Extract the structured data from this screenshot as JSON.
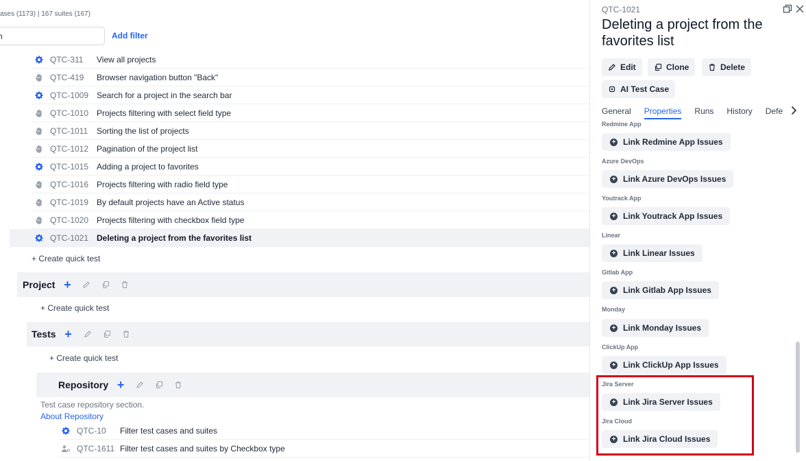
{
  "header": {
    "summary": "ases (1173) | 167 suites (167)",
    "search_value": "h",
    "add_filter": "Add filter"
  },
  "tests_top": [
    {
      "type": "automated",
      "id": "QTC-311",
      "title": "View all projects"
    },
    {
      "type": "manual",
      "id": "QTC-419",
      "title": "Browser navigation button \"Back\""
    },
    {
      "type": "automated",
      "id": "QTC-1009",
      "title": "Search for a project in the search bar"
    },
    {
      "type": "manual",
      "id": "QTC-1010",
      "title": "Projects filtering with select field type"
    },
    {
      "type": "manual",
      "id": "QTC-1011",
      "title": "Sorting the list of projects"
    },
    {
      "type": "manual",
      "id": "QTC-1012",
      "title": "Pagination of the project list"
    },
    {
      "type": "automated",
      "id": "QTC-1015",
      "title": "Adding a project to favorites"
    },
    {
      "type": "manual",
      "id": "QTC-1016",
      "title": "Projects filtering with radio field type"
    },
    {
      "type": "manual",
      "id": "QTC-1019",
      "title": "By default projects have an Active status"
    },
    {
      "type": "manual",
      "id": "QTC-1020",
      "title": "Projects filtering with checkbox field type"
    },
    {
      "type": "automated",
      "id": "QTC-1021",
      "title": "Deleting a project from the favorites list",
      "selected": true
    }
  ],
  "quick_test": "+ Create quick test",
  "suites": {
    "project": "Project",
    "tests": "Tests",
    "repository": "Repository"
  },
  "repository": {
    "description": "Test case repository section.",
    "about_link": "About Repository"
  },
  "tests_bottom": [
    {
      "type": "automated",
      "id": "QTC-10",
      "title": "Filter test cases and suites"
    },
    {
      "type": "user",
      "id": "QTC-1611",
      "title": "Filter test cases and suites by Checkbox type"
    }
  ],
  "panel": {
    "id": "QTC-1021",
    "title": "Deleting a project from the favorites list",
    "buttons": {
      "edit": "Edit",
      "clone": "Clone",
      "delete": "Delete",
      "ai": "AI Test Case"
    },
    "tabs": [
      "General",
      "Properties",
      "Runs",
      "History",
      "Defe"
    ],
    "active_tab": "Properties",
    "integrations": [
      {
        "label": "Redmine App",
        "button": "Link Redmine App Issues"
      },
      {
        "label": "Azure DevOps",
        "button": "Link Azure DevOps Issues"
      },
      {
        "label": "Youtrack App",
        "button": "Link Youtrack App Issues"
      },
      {
        "label": "Linear",
        "button": "Link Linear Issues"
      },
      {
        "label": "Gitlab App",
        "button": "Link Gitlab App Issues"
      },
      {
        "label": "Monday",
        "button": "Link Monday Issues"
      },
      {
        "label": "ClickUp App",
        "button": "Link ClickUp App Issues"
      },
      {
        "label": "Jira Server",
        "button": "Link Jira Server Issues"
      },
      {
        "label": "Jira Cloud",
        "button": "Link Jira Cloud Issues"
      }
    ]
  },
  "colors": {
    "accent": "#2563eb",
    "highlight": "#d0021b",
    "band": "#f0f2f5"
  }
}
